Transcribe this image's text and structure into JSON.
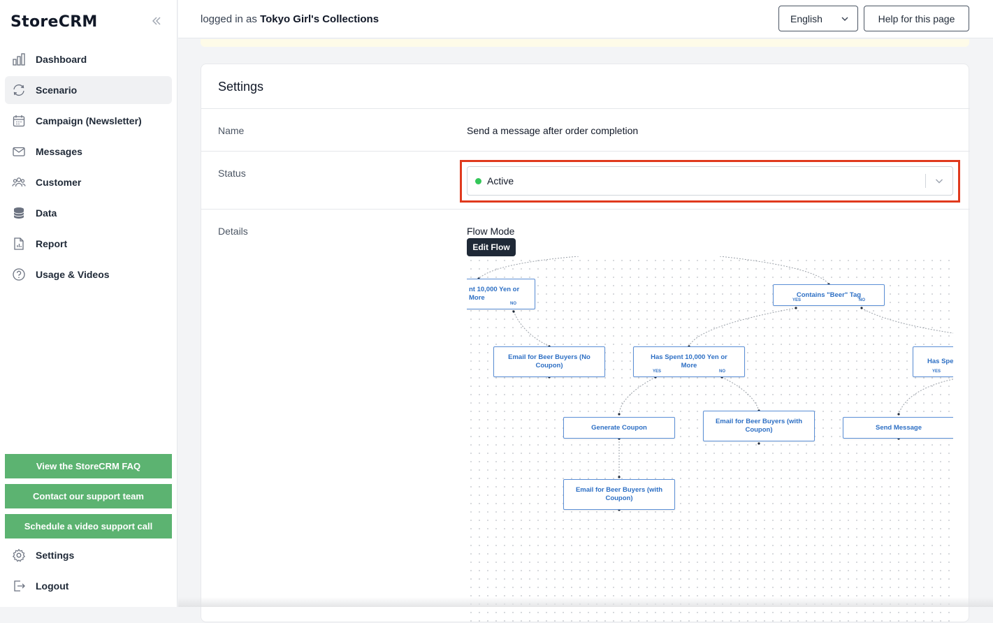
{
  "app": {
    "logo": "StoreCRM"
  },
  "sidebar": {
    "items": [
      {
        "label": "Dashboard",
        "icon": "bar-chart-icon"
      },
      {
        "label": "Scenario",
        "icon": "refresh-cycle-icon",
        "active": true
      },
      {
        "label": "Campaign (Newsletter)",
        "icon": "calendar-icon"
      },
      {
        "label": "Messages",
        "icon": "envelope-icon"
      },
      {
        "label": "Customer",
        "icon": "users-icon"
      },
      {
        "label": "Data",
        "icon": "database-icon"
      },
      {
        "label": "Report",
        "icon": "document-chart-icon"
      },
      {
        "label": "Usage & Videos",
        "icon": "question-circle-icon"
      }
    ],
    "faq_button": "View the StoreCRM FAQ",
    "support_button": "Contact our support team",
    "video_call_button": "Schedule a video support call",
    "settings_label": "Settings",
    "logout_label": "Logout",
    "accent_color": "#5cb371"
  },
  "header": {
    "logged_in_prefix": "logged in as",
    "store_name": "Tokyo Girl's Collections",
    "language": "English",
    "help_button": "Help for this page"
  },
  "settings": {
    "title": "Settings",
    "name_label": "Name",
    "name_value": "Send a message after order completion",
    "status_label": "Status",
    "status_value": "Active",
    "status_color": "#34c759",
    "highlight_color": "#e03a1e",
    "details_label": "Details",
    "flow_mode_label": "Flow Mode",
    "edit_flow_button": "Edit Flow"
  },
  "flow": {
    "nodes": {
      "spent_top_left": "nt 10,000 Yen or More",
      "contains_beer": "Contains \"Beer\" Tag",
      "email_no_coupon": "Email for Beer Buyers (No Coupon)",
      "has_spent_middle": "Has Spent 10,000 Yen or More",
      "has_spent_right": "Has Spe",
      "generate_coupon": "Generate Coupon",
      "email_with_coupon_right": "Email for Beer Buyers (with Coupon)",
      "send_message": "Send Message",
      "email_with_coupon_bottom": "Email for Beer Buyers (with Coupon)"
    },
    "yes_label": "YES",
    "no_label": "NO"
  }
}
